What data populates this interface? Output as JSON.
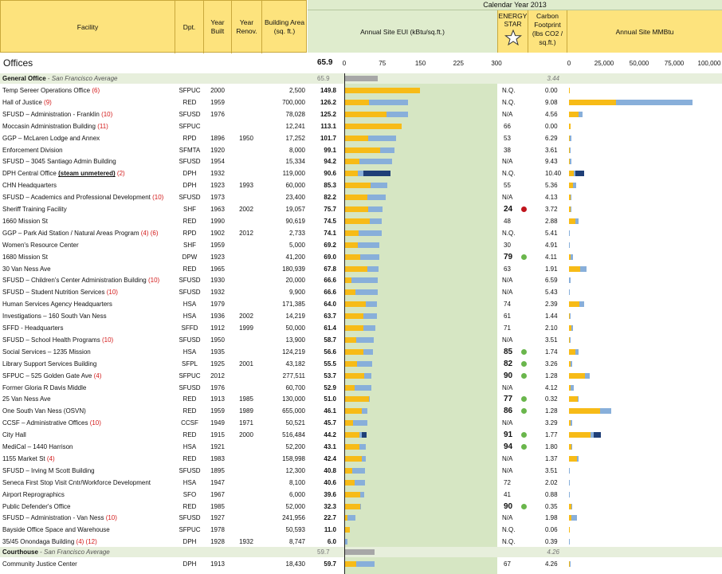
{
  "header": {
    "facility": "Facility",
    "dpt": "Dpt.",
    "year_built": "Year Built",
    "year_renov": "Year Renov.",
    "area": "Building Area (sq. ft.)",
    "calendar_year": "Calendar Year 2013",
    "eui": "Annual Site EUI (kBtu/sq.ft.)",
    "energy_star": "ENERGY STAR",
    "carbon": "Carbon Footprint (lbs CO2 / sq.ft.)",
    "mmbtu": "Annual Site MMBtu"
  },
  "section": {
    "title": "Offices",
    "eui": "65.9"
  },
  "eui_ticks": [
    "0",
    "75",
    "150",
    "225",
    "300"
  ],
  "mmbtu_ticks": [
    "0",
    "25,000",
    "50,000",
    "75,000",
    "100,000"
  ],
  "colors": {
    "header_yellow": "#fde37d",
    "header_green": "#dfeccd",
    "eui_band": "#d6e6c3",
    "yellow_bar": "#f7bb17",
    "blue_bar": "#88afda",
    "navy_bar": "#1f3f77",
    "avg_bar": "#a7a7a7",
    "note_red": "#d31a1a",
    "dot_green": "#6ab64c",
    "dot_red": "#c0141c"
  },
  "chart_data": {
    "type": "table",
    "eui_axis": {
      "min": 0,
      "max": 300,
      "ticks": [
        0,
        75,
        150,
        225,
        300
      ]
    },
    "mmbtu_axis": {
      "min": 0,
      "max": 100000,
      "ticks": [
        0,
        25000,
        50000,
        75000,
        100000
      ]
    },
    "groups": [
      {
        "title": "General Office",
        "subtitle": "San Francisco Average",
        "eui": 65.9,
        "carbon": "3.44"
      },
      {
        "title": "Courthouse",
        "subtitle": "San Francisco Average",
        "eui": 59.7,
        "carbon": "4.26"
      }
    ],
    "rows": [
      {
        "name": "Temp Sereer Operations Office",
        "note": "(6)",
        "dpt": "SFPUC",
        "built": "2000",
        "renov": "",
        "area": "2,500",
        "eui": 149.8,
        "es": "N.Q.",
        "carbon": "0.00",
        "y": 149.8,
        "b": 0,
        "n": 0,
        "mm": 374,
        "mb": 0,
        "mn": 0
      },
      {
        "name": "Hall of Justice",
        "note": "(9)",
        "dpt": "RED",
        "built": "1959",
        "renov": "",
        "area": "700,000",
        "eui": 126.2,
        "es": "N.Q.",
        "carbon": "9.08",
        "y": 48,
        "b": 78.2,
        "n": 0,
        "mm": 33600,
        "mb": 54740,
        "mn": 0
      },
      {
        "name": "SFUSD – Administration - Franklin",
        "note": "(10)",
        "dpt": "SFUSD",
        "built": "1976",
        "renov": "",
        "area": "78,028",
        "eui": 125.2,
        "es": "N/A",
        "carbon": "4.56",
        "y": 84,
        "b": 41.2,
        "n": 0,
        "mm": 6550,
        "mb": 3210,
        "mn": 0
      },
      {
        "name": "Moccasin Administration Building",
        "note": "(11)",
        "dpt": "SFPUC",
        "built": "",
        "renov": "",
        "area": "12,241",
        "eui": 113.1,
        "es": "66",
        "carbon": "0.00",
        "y": 113.1,
        "b": 0,
        "n": 0,
        "mm": 1385,
        "mb": 0,
        "mn": 0
      },
      {
        "name": "GGP – McLaren Lodge and Annex",
        "note": "",
        "dpt": "RPD",
        "built": "1896",
        "renov": "1950",
        "area": "17,252",
        "eui": 101.7,
        "es": "53",
        "carbon": "6.29",
        "y": 47,
        "b": 54.7,
        "n": 0,
        "mm": 810,
        "mb": 944,
        "mn": 0
      },
      {
        "name": "Enforcement Division",
        "note": "",
        "dpt": "SFMTA",
        "built": "1920",
        "renov": "",
        "area": "8,000",
        "eui": 99.1,
        "es": "38",
        "carbon": "3.61",
        "y": 70,
        "b": 29.1,
        "n": 0,
        "mm": 560,
        "mb": 233,
        "mn": 0
      },
      {
        "name": "SFUSD – 3045 Santiago Admin Building",
        "note": "",
        "dpt": "SFUSD",
        "built": "1954",
        "renov": "",
        "area": "15,334",
        "eui": 94.2,
        "es": "N/A",
        "carbon": "9.43",
        "y": 30,
        "b": 64.2,
        "n": 0,
        "mm": 460,
        "mb": 984,
        "mn": 0
      },
      {
        "name": "DPH Central Office",
        "link": "(steam unmetered)",
        "note": "(2)",
        "dpt": "DPH",
        "built": "1932",
        "renov": "",
        "area": "119,000",
        "eui": 90.6,
        "es": "N.Q.",
        "carbon": "10.40",
        "y": 27,
        "b": 10,
        "n": 53.6,
        "mm": 3210,
        "mb": 1190,
        "mn": 6380
      },
      {
        "name": "CHN Headquarters",
        "note": "",
        "dpt": "DPH",
        "built": "1923",
        "renov": "1993",
        "area": "60,000",
        "eui": 85.3,
        "es": "55",
        "carbon": "5.36",
        "y": 52,
        "b": 33.3,
        "n": 0,
        "mm": 3120,
        "mb": 2000,
        "mn": 0
      },
      {
        "name": "SFUSD – Academics and Professional Development",
        "note": "(10)",
        "dpt": "SFUSD",
        "built": "1973",
        "renov": "",
        "area": "23,400",
        "eui": 82.2,
        "es": "N/A",
        "carbon": "4.13",
        "y": 46,
        "b": 36.2,
        "n": 0,
        "mm": 1076,
        "mb": 847,
        "mn": 0
      },
      {
        "name": "Sheriff Training Facility",
        "note": "",
        "dpt": "SHF",
        "built": "1963",
        "renov": "2002",
        "area": "19,057",
        "eui": 75.7,
        "es": "24",
        "es_dot": "red",
        "carbon": "3.72",
        "y": 47,
        "b": 28.7,
        "n": 0,
        "mm": 896,
        "mb": 547,
        "mn": 0
      },
      {
        "name": "1660 Mission St",
        "note": "",
        "dpt": "RED",
        "built": "1990",
        "renov": "",
        "area": "90,619",
        "eui": 74.5,
        "es": "48",
        "carbon": "2.88",
        "y": 50,
        "b": 24.5,
        "n": 0,
        "mm": 4530,
        "mb": 2220,
        "mn": 0
      },
      {
        "name": "GGP – Park Aid Station / Natural Areas Program",
        "note": "(4) (6)",
        "dpt": "RPD",
        "built": "1902",
        "renov": "2012",
        "area": "2,733",
        "eui": 74.1,
        "es": "N.Q.",
        "carbon": "5.41",
        "y": 28,
        "b": 46.1,
        "n": 0,
        "mm": 77,
        "mb": 126,
        "mn": 0
      },
      {
        "name": "Women's Resource Center",
        "note": "",
        "dpt": "SHF",
        "built": "1959",
        "renov": "",
        "area": "5,000",
        "eui": 69.2,
        "es": "30",
        "carbon": "4.91",
        "y": 27,
        "b": 42.2,
        "n": 0,
        "mm": 135,
        "mb": 211,
        "mn": 0
      },
      {
        "name": "1680 Mission St",
        "note": "",
        "dpt": "DPW",
        "built": "1923",
        "renov": "",
        "area": "41,200",
        "eui": 69.0,
        "es": "79",
        "es_dot": "green",
        "carbon": "4.11",
        "y": 32,
        "b": 37,
        "n": 0,
        "mm": 1320,
        "mb": 1524,
        "mn": 0
      },
      {
        "name": "30 Van Ness Ave",
        "note": "",
        "dpt": "RED",
        "built": "1965",
        "renov": "",
        "area": "180,939",
        "eui": 67.8,
        "es": "63",
        "carbon": "1.91",
        "y": 45,
        "b": 22.8,
        "n": 0,
        "mm": 8140,
        "mb": 4125,
        "mn": 0
      },
      {
        "name": "SFUSD – Children's Center Administration Building",
        "note": "(10)",
        "dpt": "SFUSD",
        "built": "1930",
        "renov": "",
        "area": "20,000",
        "eui": 66.6,
        "es": "N/A",
        "carbon": "6.59",
        "y": 14,
        "b": 52.6,
        "n": 0,
        "mm": 280,
        "mb": 1052,
        "mn": 0
      },
      {
        "name": "SFUSD – Student Nutrition Services",
        "note": "(10)",
        "dpt": "SFUSD",
        "built": "1932",
        "renov": "",
        "area": "9,900",
        "eui": 66.6,
        "es": "N/A",
        "carbon": "5.43",
        "y": 22,
        "b": 44.6,
        "n": 0,
        "mm": 218,
        "mb": 442,
        "mn": 0
      },
      {
        "name": "Human Services Agency Headquarters",
        "note": "",
        "dpt": "HSA",
        "built": "1979",
        "renov": "",
        "area": "171,385",
        "eui": 64.0,
        "es": "74",
        "carbon": "2.39",
        "y": 42,
        "b": 22,
        "n": 0,
        "mm": 7200,
        "mb": 3770,
        "mn": 0
      },
      {
        "name": "Investigations – 160 South Van Ness",
        "note": "",
        "dpt": "HSA",
        "built": "1936",
        "renov": "2002",
        "area": "14,219",
        "eui": 63.7,
        "es": "61",
        "carbon": "1.44",
        "y": 38,
        "b": 25.7,
        "n": 0,
        "mm": 540,
        "mb": 365,
        "mn": 0
      },
      {
        "name": "SFFD - Headquarters",
        "note": "",
        "dpt": "SFFD",
        "built": "1912",
        "renov": "1999",
        "area": "50,000",
        "eui": 61.4,
        "es": "71",
        "carbon": "2.10",
        "y": 37,
        "b": 24.4,
        "n": 0,
        "mm": 1850,
        "mb": 1220,
        "mn": 0
      },
      {
        "name": "SFUSD – School Health Programs",
        "note": "(10)",
        "dpt": "SFUSD",
        "built": "1950",
        "renov": "",
        "area": "13,900",
        "eui": 58.7,
        "es": "N/A",
        "carbon": "3.51",
        "y": 23,
        "b": 35.7,
        "n": 0,
        "mm": 320,
        "mb": 496,
        "mn": 0
      },
      {
        "name": "Social Services – 1235 Mission",
        "note": "",
        "dpt": "HSA",
        "built": "1935",
        "renov": "",
        "area": "124,219",
        "eui": 56.6,
        "es": "85",
        "es_dot": "green",
        "carbon": "1.74",
        "y": 38,
        "b": 18.6,
        "n": 0,
        "mm": 4720,
        "mb": 2310,
        "mn": 0
      },
      {
        "name": "Library Support Services Building",
        "note": "",
        "dpt": "SFPL",
        "built": "1925",
        "renov": "2001",
        "area": "43,182",
        "eui": 55.5,
        "es": "82",
        "es_dot": "green",
        "carbon": "3.26",
        "y": 25,
        "b": 30.5,
        "n": 0,
        "mm": 1080,
        "mb": 1317,
        "mn": 0
      },
      {
        "name": "SFPUC – 525 Golden Gate Ave",
        "note": "(4)",
        "dpt": "SFPUC",
        "built": "2012",
        "renov": "",
        "area": "277,511",
        "eui": 53.7,
        "es": "90",
        "es_dot": "green",
        "carbon": "1.28",
        "y": 40,
        "b": 13.7,
        "n": 0,
        "mm": 11100,
        "mb": 3800,
        "mn": 0
      },
      {
        "name": "Former Gloria R Davis Middle",
        "note": "",
        "dpt": "SFUSD",
        "built": "1976",
        "renov": "",
        "area": "60,700",
        "eui": 52.9,
        "es": "N/A",
        "carbon": "4.12",
        "y": 20,
        "b": 32.9,
        "n": 0,
        "mm": 1214,
        "mb": 1997,
        "mn": 0
      },
      {
        "name": "25 Van Ness Ave",
        "note": "",
        "dpt": "RED",
        "built": "1913",
        "renov": "1985",
        "area": "130,000",
        "eui": 51.0,
        "es": "77",
        "es_dot": "green",
        "carbon": "0.32",
        "y": 49,
        "b": 2,
        "n": 0,
        "mm": 6370,
        "mb": 260,
        "mn": 0
      },
      {
        "name": "One South Van Ness (OSVN)",
        "note": "",
        "dpt": "RED",
        "built": "1959",
        "renov": "1989",
        "area": "655,000",
        "eui": 46.1,
        "es": "86",
        "es_dot": "green",
        "carbon": "1.28",
        "y": 34,
        "b": 12.1,
        "n": 0,
        "mm": 22270,
        "mb": 7925,
        "mn": 0
      },
      {
        "name": "CCSF – Administrative Offices",
        "note": "(10)",
        "dpt": "CCSF",
        "built": "1949",
        "renov": "1971",
        "area": "50,521",
        "eui": 45.7,
        "es": "N/A",
        "carbon": "3.29",
        "y": 17,
        "b": 28.7,
        "n": 0,
        "mm": 859,
        "mb": 1450,
        "mn": 0
      },
      {
        "name": "City Hall",
        "note": "",
        "dpt": "RED",
        "built": "1915",
        "renov": "2000",
        "area": "516,484",
        "eui": 44.2,
        "es": "91",
        "es_dot": "green",
        "carbon": "1.77",
        "y": 30,
        "b": 4,
        "n": 10.2,
        "mm": 15490,
        "mb": 2070,
        "mn": 5270
      },
      {
        "name": "MediCal – 1440 Harrison",
        "note": "",
        "dpt": "HSA",
        "built": "1921",
        "renov": "",
        "area": "52,200",
        "eui": 43.1,
        "es": "94",
        "es_dot": "green",
        "carbon": "1.80",
        "y": 30,
        "b": 13.1,
        "n": 0,
        "mm": 1566,
        "mb": 684,
        "mn": 0
      },
      {
        "name": "1155 Market St",
        "note": "(4)",
        "dpt": "RED",
        "built": "1983",
        "renov": "",
        "area": "158,998",
        "eui": 42.4,
        "es": "N/A",
        "carbon": "1.37",
        "y": 34,
        "b": 8.4,
        "n": 0,
        "mm": 5400,
        "mb": 1336,
        "mn": 0
      },
      {
        "name": "SFUSD – Irving M Scott Building",
        "note": "",
        "dpt": "SFUSD",
        "built": "1895",
        "renov": "",
        "area": "12,300",
        "eui": 40.8,
        "es": "N/A",
        "carbon": "3.51",
        "y": 16,
        "b": 24.8,
        "n": 0,
        "mm": 197,
        "mb": 305,
        "mn": 0
      },
      {
        "name": "Seneca First Stop Visit Cntr/Workforce Development",
        "note": "",
        "dpt": "HSA",
        "built": "1947",
        "renov": "",
        "area": "8,100",
        "eui": 40.6,
        "es": "72",
        "carbon": "2.02",
        "y": 20,
        "b": 20.6,
        "n": 0,
        "mm": 162,
        "mb": 167,
        "mn": 0
      },
      {
        "name": "Airport Reprographics",
        "note": "",
        "dpt": "SFO",
        "built": "1967",
        "renov": "",
        "area": "6,000",
        "eui": 39.6,
        "es": "41",
        "carbon": "0.88",
        "y": 32,
        "b": 7.6,
        "n": 0,
        "mm": 192,
        "mb": 46,
        "mn": 0
      },
      {
        "name": "Public Defender's Office",
        "note": "",
        "dpt": "RED",
        "built": "1985",
        "renov": "",
        "area": "52,000",
        "eui": 32.3,
        "es": "90",
        "es_dot": "green",
        "carbon": "0.35",
        "y": 31,
        "b": 1.3,
        "n": 0,
        "mm": 1612,
        "mb": 68,
        "mn": 0
      },
      {
        "name": "SFUSD – Administration - Van Ness",
        "note": "(10)",
        "dpt": "SFUSD",
        "built": "1927",
        "renov": "",
        "area": "241,956",
        "eui": 22.7,
        "es": "N/A",
        "carbon": "1.98",
        "y": 6,
        "b": 16.7,
        "n": 0,
        "mm": 1450,
        "mb": 4040,
        "mn": 0
      },
      {
        "name": "Bayside Office Space and Warehouse",
        "note": "",
        "dpt": "SFPUC",
        "built": "1978",
        "renov": "",
        "area": "50,593",
        "eui": 11.0,
        "es": "N.Q.",
        "carbon": "0.06",
        "y": 11,
        "b": 0,
        "n": 0,
        "mm": 557,
        "mb": 0,
        "mn": 0
      },
      {
        "name": "35/45 Onondaga Building",
        "note": "(4) (12)",
        "dpt": "DPH",
        "built": "1928",
        "renov": "1932",
        "area": "8,747",
        "eui": 6.0,
        "es": "N.Q.",
        "carbon": "0.39",
        "y": 2,
        "b": 4,
        "n": 0,
        "mm": 17,
        "mb": 35,
        "mn": 0
      },
      {
        "name": "Community Justice Center",
        "note": "",
        "dpt": "DPH",
        "built": "1913",
        "renov": "",
        "area": "18,430",
        "eui": 59.7,
        "es": "67",
        "carbon": "4.26",
        "y": 23,
        "b": 36.7,
        "n": 0,
        "mm": 424,
        "mb": 676,
        "mn": 0
      }
    ]
  }
}
